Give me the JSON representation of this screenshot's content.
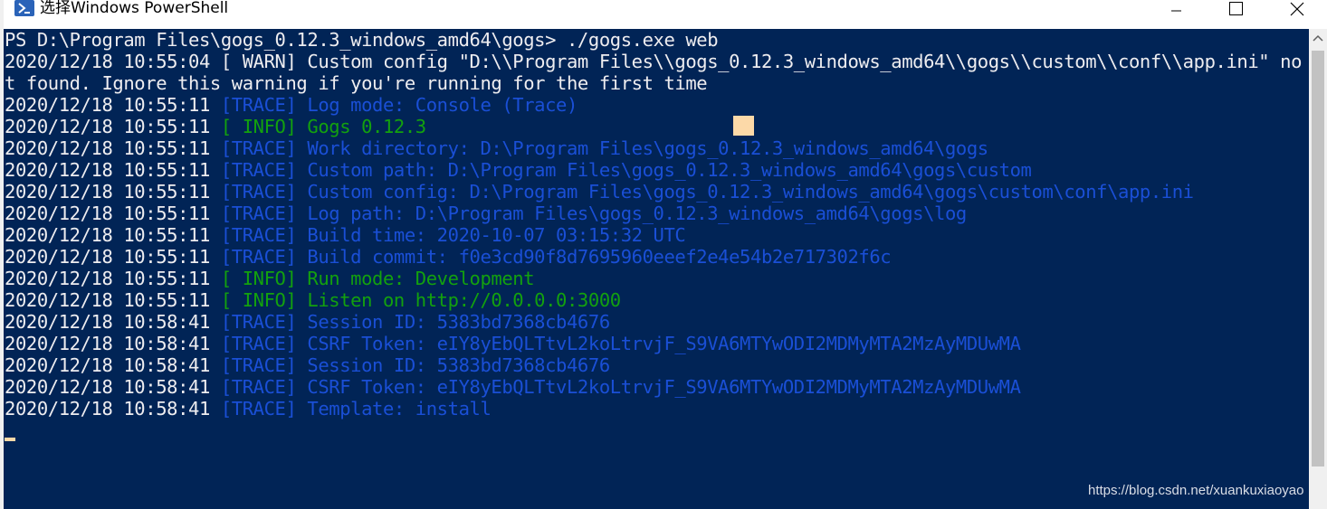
{
  "window": {
    "title": "选择Windows PowerShell",
    "icon": "powershell-icon"
  },
  "controls": {
    "minimize_icon": "minimize-icon",
    "maximize_icon": "maximize-icon",
    "close_icon": "close-icon"
  },
  "colors": {
    "console_bg": "#012456",
    "text_default": "#eeedf0",
    "trace": "#1a4fd6",
    "info": "#13a10e",
    "cursor": "#fcd9a8"
  },
  "console": {
    "lines": [
      {
        "segments": [
          {
            "text": "PS D:\\Program Files\\gogs_0.12.3_windows_amd64\\gogs> ./gogs.exe web",
            "style": "white"
          }
        ]
      },
      {
        "segments": [
          {
            "text": "2020/12/18 10:55:04 [ WARN] Custom config \"D:\\\\Program Files\\\\gogs_0.12.3_windows_amd64\\\\gogs\\\\custom\\\\conf\\\\app.ini\" no",
            "style": "warn"
          }
        ]
      },
      {
        "segments": [
          {
            "text": "t found. Ignore this warning if you're running for the first time",
            "style": "warn"
          }
        ]
      },
      {
        "segments": [
          {
            "text": "2020/12/18 10:55:11 ",
            "style": "white"
          },
          {
            "text": "[TRACE] Log mode: Console (Trace)",
            "style": "trace"
          }
        ]
      },
      {
        "segments": [
          {
            "text": "2020/12/18 10:55:11 ",
            "style": "white"
          },
          {
            "text": "[ INFO] Gogs 0.12.3",
            "style": "info"
          }
        ]
      },
      {
        "segments": [
          {
            "text": "2020/12/18 10:55:11 ",
            "style": "white"
          },
          {
            "text": "[TRACE] Work directory: D:\\Program Files\\gogs_0.12.3_windows_amd64\\gogs",
            "style": "trace"
          }
        ]
      },
      {
        "segments": [
          {
            "text": "2020/12/18 10:55:11 ",
            "style": "white"
          },
          {
            "text": "[TRACE] Custom path: D:\\Program Files\\gogs_0.12.3_windows_amd64\\gogs\\custom",
            "style": "trace"
          }
        ]
      },
      {
        "segments": [
          {
            "text": "2020/12/18 10:55:11 ",
            "style": "white"
          },
          {
            "text": "[TRACE] Custom config: D:\\Program Files\\gogs_0.12.3_windows_amd64\\gogs\\custom\\conf\\app.ini",
            "style": "trace"
          }
        ]
      },
      {
        "segments": [
          {
            "text": "2020/12/18 10:55:11 ",
            "style": "white"
          },
          {
            "text": "[TRACE] Log path: D:\\Program Files\\gogs_0.12.3_windows_amd64\\gogs\\log",
            "style": "trace"
          }
        ]
      },
      {
        "segments": [
          {
            "text": "2020/12/18 10:55:11 ",
            "style": "white"
          },
          {
            "text": "[TRACE] Build time: 2020-10-07 03:15:32 UTC",
            "style": "trace"
          }
        ]
      },
      {
        "segments": [
          {
            "text": "2020/12/18 10:55:11 ",
            "style": "white"
          },
          {
            "text": "[TRACE] Build commit: f0e3cd90f8d7695960eeef2e4e54b2e717302f6c",
            "style": "trace"
          }
        ]
      },
      {
        "segments": [
          {
            "text": "2020/12/18 10:55:11 ",
            "style": "white"
          },
          {
            "text": "[ INFO] Run mode: Development",
            "style": "info"
          }
        ]
      },
      {
        "segments": [
          {
            "text": "2020/12/18 10:55:11 ",
            "style": "white"
          },
          {
            "text": "[ INFO] Listen on http://0.0.0.0:3000",
            "style": "info"
          }
        ]
      },
      {
        "segments": [
          {
            "text": "2020/12/18 10:58:41 ",
            "style": "white"
          },
          {
            "text": "[TRACE] Session ID: 5383bd7368cb4676",
            "style": "trace"
          }
        ]
      },
      {
        "segments": [
          {
            "text": "2020/12/18 10:58:41 ",
            "style": "white"
          },
          {
            "text": "[TRACE] CSRF Token: eIY8yEbQLTtvL2koLtrvjF_S9VA6MTYwODI2MDMyMTA2MzAyMDUwMA",
            "style": "trace"
          }
        ]
      },
      {
        "segments": [
          {
            "text": "2020/12/18 10:58:41 ",
            "style": "white"
          },
          {
            "text": "[TRACE] Session ID: 5383bd7368cb4676",
            "style": "trace"
          }
        ]
      },
      {
        "segments": [
          {
            "text": "2020/12/18 10:58:41 ",
            "style": "white"
          },
          {
            "text": "[TRACE] CSRF Token: eIY8yEbQLTtvL2koLtrvjF_S9VA6MTYwODI2MDMyMTA2MzAyMDUwMA",
            "style": "trace"
          }
        ]
      },
      {
        "segments": [
          {
            "text": "2020/12/18 10:58:41 ",
            "style": "white"
          },
          {
            "text": "[TRACE] Template: install",
            "style": "trace"
          }
        ]
      }
    ]
  },
  "watermark": "https://blog.csdn.net/xuankuxiaoyao"
}
